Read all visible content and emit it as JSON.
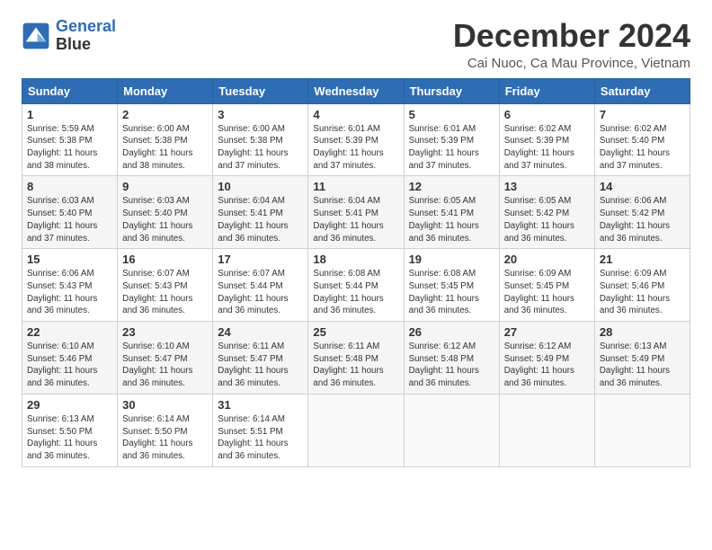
{
  "logo": {
    "name_line1": "General",
    "name_line2": "Blue"
  },
  "header": {
    "month": "December 2024",
    "location": "Cai Nuoc, Ca Mau Province, Vietnam"
  },
  "days_of_week": [
    "Sunday",
    "Monday",
    "Tuesday",
    "Wednesday",
    "Thursday",
    "Friday",
    "Saturday"
  ],
  "weeks": [
    [
      {
        "day": "1",
        "sunrise": "Sunrise: 5:59 AM",
        "sunset": "Sunset: 5:38 PM",
        "daylight": "Daylight: 11 hours and 38 minutes."
      },
      {
        "day": "2",
        "sunrise": "Sunrise: 6:00 AM",
        "sunset": "Sunset: 5:38 PM",
        "daylight": "Daylight: 11 hours and 38 minutes."
      },
      {
        "day": "3",
        "sunrise": "Sunrise: 6:00 AM",
        "sunset": "Sunset: 5:38 PM",
        "daylight": "Daylight: 11 hours and 37 minutes."
      },
      {
        "day": "4",
        "sunrise": "Sunrise: 6:01 AM",
        "sunset": "Sunset: 5:39 PM",
        "daylight": "Daylight: 11 hours and 37 minutes."
      },
      {
        "day": "5",
        "sunrise": "Sunrise: 6:01 AM",
        "sunset": "Sunset: 5:39 PM",
        "daylight": "Daylight: 11 hours and 37 minutes."
      },
      {
        "day": "6",
        "sunrise": "Sunrise: 6:02 AM",
        "sunset": "Sunset: 5:39 PM",
        "daylight": "Daylight: 11 hours and 37 minutes."
      },
      {
        "day": "7",
        "sunrise": "Sunrise: 6:02 AM",
        "sunset": "Sunset: 5:40 PM",
        "daylight": "Daylight: 11 hours and 37 minutes."
      }
    ],
    [
      {
        "day": "8",
        "sunrise": "Sunrise: 6:03 AM",
        "sunset": "Sunset: 5:40 PM",
        "daylight": "Daylight: 11 hours and 37 minutes."
      },
      {
        "day": "9",
        "sunrise": "Sunrise: 6:03 AM",
        "sunset": "Sunset: 5:40 PM",
        "daylight": "Daylight: 11 hours and 36 minutes."
      },
      {
        "day": "10",
        "sunrise": "Sunrise: 6:04 AM",
        "sunset": "Sunset: 5:41 PM",
        "daylight": "Daylight: 11 hours and 36 minutes."
      },
      {
        "day": "11",
        "sunrise": "Sunrise: 6:04 AM",
        "sunset": "Sunset: 5:41 PM",
        "daylight": "Daylight: 11 hours and 36 minutes."
      },
      {
        "day": "12",
        "sunrise": "Sunrise: 6:05 AM",
        "sunset": "Sunset: 5:41 PM",
        "daylight": "Daylight: 11 hours and 36 minutes."
      },
      {
        "day": "13",
        "sunrise": "Sunrise: 6:05 AM",
        "sunset": "Sunset: 5:42 PM",
        "daylight": "Daylight: 11 hours and 36 minutes."
      },
      {
        "day": "14",
        "sunrise": "Sunrise: 6:06 AM",
        "sunset": "Sunset: 5:42 PM",
        "daylight": "Daylight: 11 hours and 36 minutes."
      }
    ],
    [
      {
        "day": "15",
        "sunrise": "Sunrise: 6:06 AM",
        "sunset": "Sunset: 5:43 PM",
        "daylight": "Daylight: 11 hours and 36 minutes."
      },
      {
        "day": "16",
        "sunrise": "Sunrise: 6:07 AM",
        "sunset": "Sunset: 5:43 PM",
        "daylight": "Daylight: 11 hours and 36 minutes."
      },
      {
        "day": "17",
        "sunrise": "Sunrise: 6:07 AM",
        "sunset": "Sunset: 5:44 PM",
        "daylight": "Daylight: 11 hours and 36 minutes."
      },
      {
        "day": "18",
        "sunrise": "Sunrise: 6:08 AM",
        "sunset": "Sunset: 5:44 PM",
        "daylight": "Daylight: 11 hours and 36 minutes."
      },
      {
        "day": "19",
        "sunrise": "Sunrise: 6:08 AM",
        "sunset": "Sunset: 5:45 PM",
        "daylight": "Daylight: 11 hours and 36 minutes."
      },
      {
        "day": "20",
        "sunrise": "Sunrise: 6:09 AM",
        "sunset": "Sunset: 5:45 PM",
        "daylight": "Daylight: 11 hours and 36 minutes."
      },
      {
        "day": "21",
        "sunrise": "Sunrise: 6:09 AM",
        "sunset": "Sunset: 5:46 PM",
        "daylight": "Daylight: 11 hours and 36 minutes."
      }
    ],
    [
      {
        "day": "22",
        "sunrise": "Sunrise: 6:10 AM",
        "sunset": "Sunset: 5:46 PM",
        "daylight": "Daylight: 11 hours and 36 minutes."
      },
      {
        "day": "23",
        "sunrise": "Sunrise: 6:10 AM",
        "sunset": "Sunset: 5:47 PM",
        "daylight": "Daylight: 11 hours and 36 minutes."
      },
      {
        "day": "24",
        "sunrise": "Sunrise: 6:11 AM",
        "sunset": "Sunset: 5:47 PM",
        "daylight": "Daylight: 11 hours and 36 minutes."
      },
      {
        "day": "25",
        "sunrise": "Sunrise: 6:11 AM",
        "sunset": "Sunset: 5:48 PM",
        "daylight": "Daylight: 11 hours and 36 minutes."
      },
      {
        "day": "26",
        "sunrise": "Sunrise: 6:12 AM",
        "sunset": "Sunset: 5:48 PM",
        "daylight": "Daylight: 11 hours and 36 minutes."
      },
      {
        "day": "27",
        "sunrise": "Sunrise: 6:12 AM",
        "sunset": "Sunset: 5:49 PM",
        "daylight": "Daylight: 11 hours and 36 minutes."
      },
      {
        "day": "28",
        "sunrise": "Sunrise: 6:13 AM",
        "sunset": "Sunset: 5:49 PM",
        "daylight": "Daylight: 11 hours and 36 minutes."
      }
    ],
    [
      {
        "day": "29",
        "sunrise": "Sunrise: 6:13 AM",
        "sunset": "Sunset: 5:50 PM",
        "daylight": "Daylight: 11 hours and 36 minutes."
      },
      {
        "day": "30",
        "sunrise": "Sunrise: 6:14 AM",
        "sunset": "Sunset: 5:50 PM",
        "daylight": "Daylight: 11 hours and 36 minutes."
      },
      {
        "day": "31",
        "sunrise": "Sunrise: 6:14 AM",
        "sunset": "Sunset: 5:51 PM",
        "daylight": "Daylight: 11 hours and 36 minutes."
      },
      {
        "day": "",
        "sunrise": "",
        "sunset": "",
        "daylight": ""
      },
      {
        "day": "",
        "sunrise": "",
        "sunset": "",
        "daylight": ""
      },
      {
        "day": "",
        "sunrise": "",
        "sunset": "",
        "daylight": ""
      },
      {
        "day": "",
        "sunrise": "",
        "sunset": "",
        "daylight": ""
      }
    ]
  ]
}
